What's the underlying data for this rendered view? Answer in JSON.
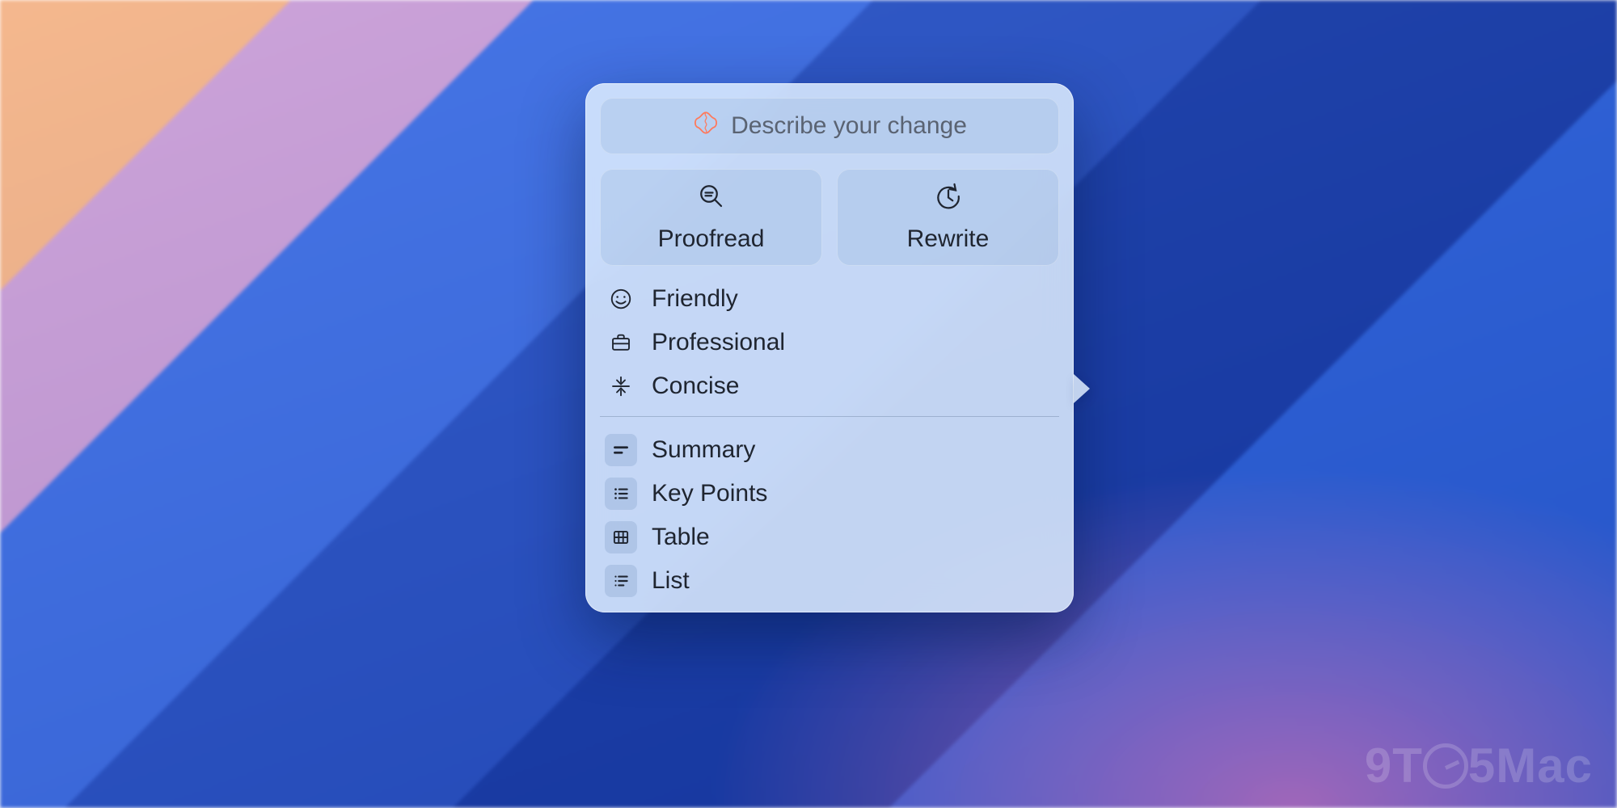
{
  "describe": {
    "placeholder": "Describe your change"
  },
  "actions": {
    "proofread": "Proofread",
    "rewrite": "Rewrite"
  },
  "tones": {
    "friendly": "Friendly",
    "professional": "Professional",
    "concise": "Concise"
  },
  "formats": {
    "summary": "Summary",
    "keypoints": "Key Points",
    "table": "Table",
    "list": "List"
  },
  "watermark": {
    "prefix": "9T",
    "suffix": "5Mac"
  }
}
